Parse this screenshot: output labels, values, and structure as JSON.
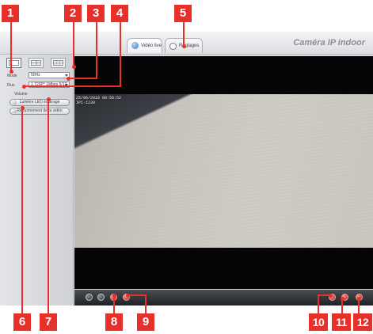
{
  "app": {
    "brand": "Caméra IP indoor",
    "tabs": [
      {
        "label": "Vidéo live",
        "icon": "video-icon"
      },
      {
        "label": "Réglages",
        "icon": "settings-icon"
      }
    ]
  },
  "sidebar": {
    "layouts": [
      "single-view-icon",
      "four-view-grid-icon",
      "nine-view-grid-icon"
    ],
    "mode_label": "Mode",
    "mode_value": "50Hz",
    "flux_label": "Flux",
    "flux_value": "1 720P* 1Mbps 5/12",
    "volume_label": "Volume",
    "buttons": [
      {
        "label": "Lumière LED éclairage"
      },
      {
        "label": "Retournement de la vidéo"
      }
    ]
  },
  "video": {
    "osd_date": "25/06/2016 08:56:52",
    "osd_name": "IPC-1239"
  },
  "controls": {
    "left": [
      "play-icon",
      "stop-icon",
      "record-icon",
      "snapshot-icon"
    ],
    "right": [
      "audio-icon",
      "microphone-icon",
      "fullscreen-icon"
    ]
  },
  "callouts": [
    "1",
    "2",
    "3",
    "4",
    "5",
    "6",
    "7",
    "8",
    "9",
    "10",
    "11",
    "12"
  ],
  "colors": {
    "callout": "#e8302a",
    "video_background": "#050505"
  }
}
